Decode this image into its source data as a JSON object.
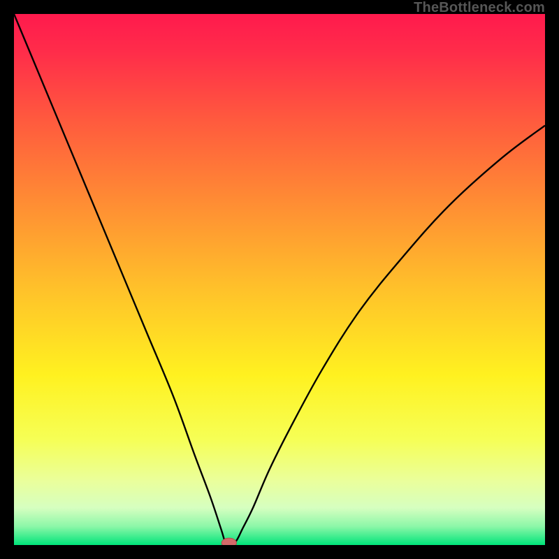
{
  "watermark": "TheBottleneck.com",
  "colors": {
    "gradient_stops": [
      {
        "offset": 0.0,
        "color": "#ff1a4d"
      },
      {
        "offset": 0.07,
        "color": "#ff2c4a"
      },
      {
        "offset": 0.2,
        "color": "#ff5a3e"
      },
      {
        "offset": 0.35,
        "color": "#ff8b34"
      },
      {
        "offset": 0.52,
        "color": "#ffc22a"
      },
      {
        "offset": 0.68,
        "color": "#fff120"
      },
      {
        "offset": 0.8,
        "color": "#f6ff55"
      },
      {
        "offset": 0.88,
        "color": "#eaff9c"
      },
      {
        "offset": 0.93,
        "color": "#d6ffc0"
      },
      {
        "offset": 0.965,
        "color": "#8cf7a8"
      },
      {
        "offset": 1.0,
        "color": "#00e47a"
      }
    ],
    "curve": "#000000",
    "marker_fill": "#d46a6a",
    "marker_stroke": "#b44d4d",
    "frame": "#000000"
  },
  "chart_data": {
    "type": "line",
    "title": "",
    "xlabel": "",
    "ylabel": "",
    "xlim": [
      0,
      100
    ],
    "ylim": [
      0,
      100
    ],
    "series": [
      {
        "name": "bottleneck_curve",
        "x": [
          0,
          5,
          10,
          15,
          20,
          25,
          30,
          34,
          37,
          39,
          40,
          41,
          42,
          43,
          45,
          48,
          52,
          58,
          65,
          73,
          82,
          92,
          100
        ],
        "y": [
          100,
          88,
          76,
          64,
          52,
          40,
          28,
          17,
          9,
          3,
          0,
          0,
          1,
          3,
          7,
          14,
          22,
          33,
          44,
          54,
          64,
          73,
          79
        ]
      }
    ],
    "marker": {
      "x": 40.5,
      "y": 0.4,
      "rx": 1.4,
      "ry": 0.9
    }
  }
}
